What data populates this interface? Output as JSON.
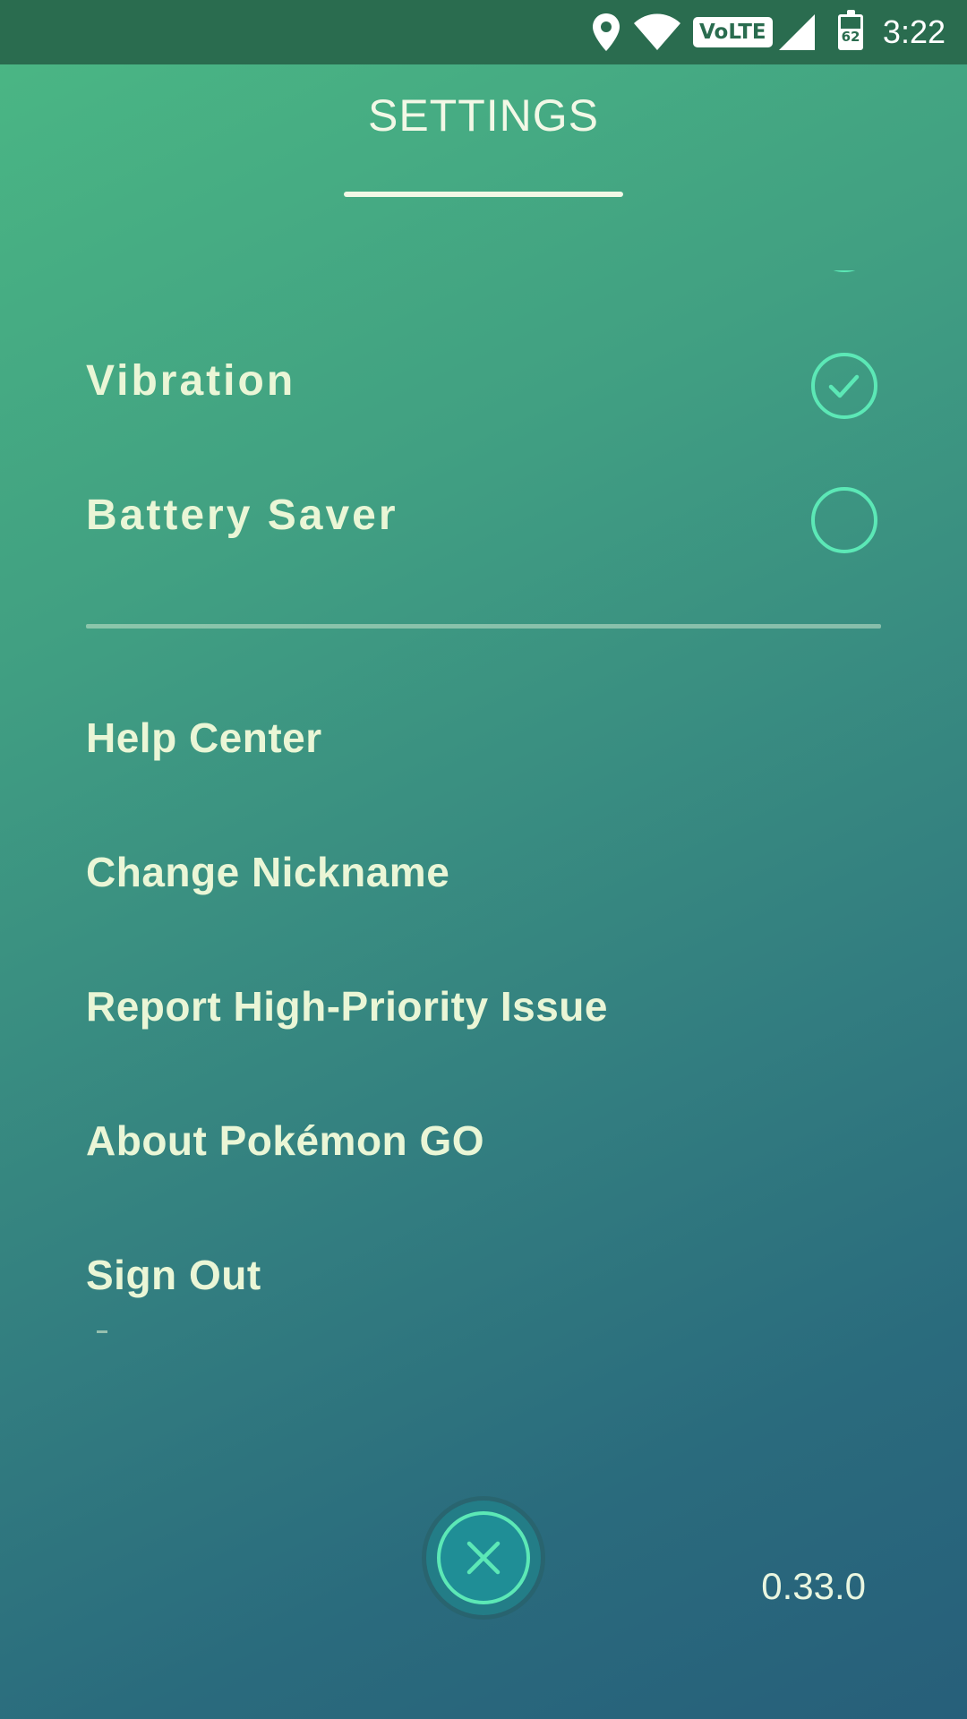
{
  "status_bar": {
    "time": "3:22",
    "volte_label": "VoLTE",
    "battery_percent": "62",
    "icons": [
      "location-icon",
      "wifi-icon",
      "volte-icon",
      "cell-signal-icon",
      "battery-icon"
    ]
  },
  "header": {
    "title": "SETTINGS"
  },
  "settings": [
    {
      "label": "Vibration",
      "checked": true
    },
    {
      "label": "Battery Saver",
      "checked": false
    }
  ],
  "menu": {
    "items": [
      "Help Center",
      "Change Nickname",
      "Report High-Priority Issue",
      "About Pokémon GO",
      "Sign Out"
    ]
  },
  "footer": {
    "version": "0.33.0",
    "close_icon": "close-icon"
  },
  "colors": {
    "accent": "#5ce8b6",
    "status_bar": "#2a6c4f",
    "text": "#eaf6d6"
  }
}
